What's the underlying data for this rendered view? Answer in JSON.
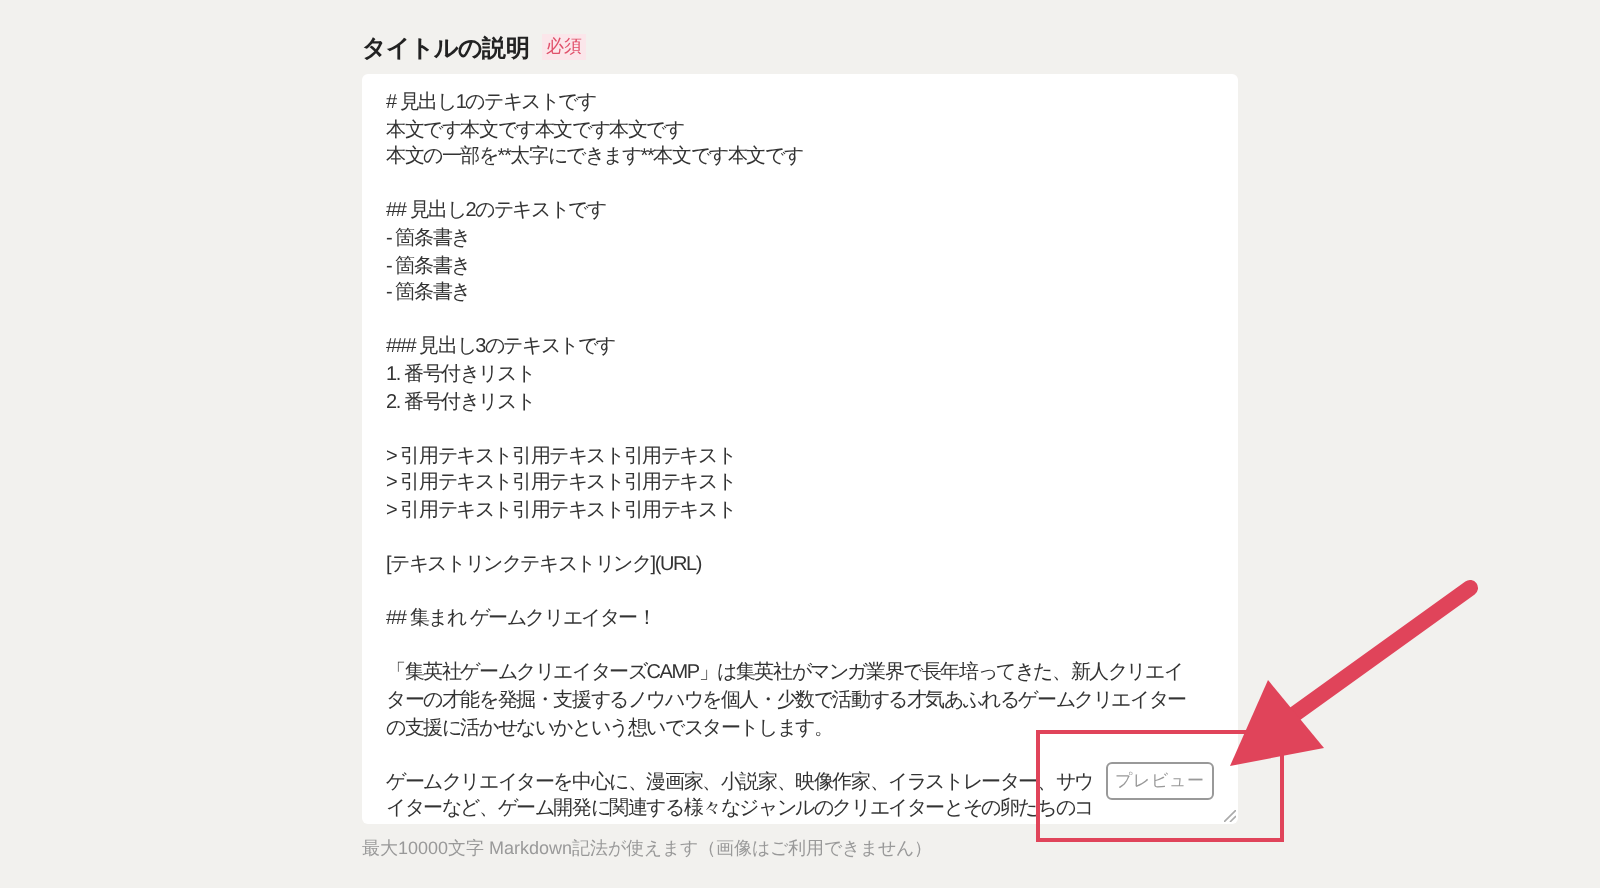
{
  "field": {
    "label": "タイトルの説明",
    "required_badge": "必須",
    "value_paragraphs": [
      [
        "# 見出し1のテキストです",
        "本文です本文です本文です本文です",
        "本文の一部を**太字にできます**本文です本文です"
      ],
      [
        "## 見出し2のテキストです",
        "- 箇条書き",
        "- 箇条書き",
        "- 箇条書き"
      ],
      [
        "### 見出し3のテキストです",
        "1. 番号付きリスト",
        "2. 番号付きリスト"
      ],
      [
        "> 引用テキスト引用テキスト引用テキスト",
        "> 引用テキスト引用テキスト引用テキスト",
        "> 引用テキスト引用テキスト引用テキスト"
      ],
      [
        "[テキストリンクテキストリンク](URL)"
      ],
      [
        "## 集まれ ゲームクリエイター！"
      ],
      [
        "「集英社ゲームクリエイターズCAMP」は集英社がマンガ業界で長年培ってきた、新人クリエイ",
        "ターの才能を発掘・支援するノウハウを個人・少数で活動する才気あふれるゲームクリエイター",
        "の支援に活かせないかという想いでスタートします。"
      ],
      [
        "ゲームクリエイターを中心に、漫画家、小説家、映像作家、イラストレーター、サウ",
        "イターなど、ゲーム開発に関連する様々なジャンルのクリエイターとその卵たちのコ"
      ]
    ],
    "preview_button": "プレビュー",
    "hint": "最大10000文字 Markdown記法が使えます（画像はご利用できません）"
  }
}
